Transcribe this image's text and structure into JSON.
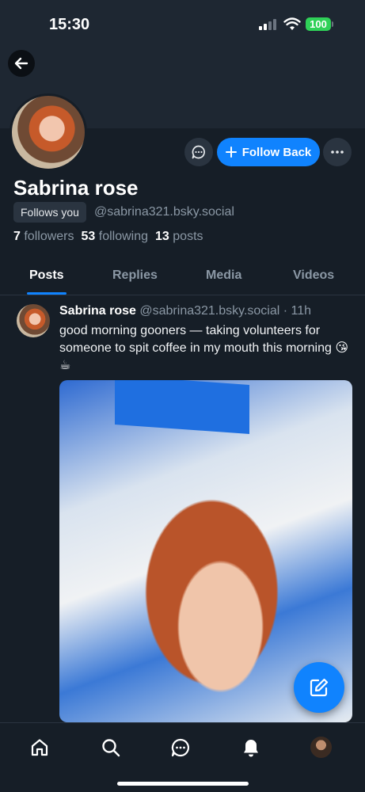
{
  "status_bar": {
    "time": "15:30",
    "battery": "100"
  },
  "profile": {
    "display_name": "Sabrina rose",
    "follows_you": "Follows you",
    "handle": "@sabrina321.bsky.social",
    "followers_count": "7",
    "followers_label": "followers",
    "following_count": "53",
    "following_label": "following",
    "posts_count": "13",
    "posts_label": "posts",
    "follow_button": "Follow Back"
  },
  "tabs": [
    {
      "label": "Posts",
      "active": true
    },
    {
      "label": "Replies",
      "active": false
    },
    {
      "label": "Media",
      "active": false
    },
    {
      "label": "Videos",
      "active": false
    }
  ],
  "post": {
    "author": "Sabrina rose",
    "handle": "@sabrina321.bsky.social",
    "separator": "·",
    "time": "11h",
    "text": "good morning gooners — taking volunteers for someone to spit coffee in my mouth this morning 😘☕"
  },
  "colors": {
    "accent": "#1083fe",
    "background": "#161e27",
    "banner": "#1e2732"
  },
  "icons": {
    "back": "arrow-left-icon",
    "message": "chat-bubble-icon",
    "more": "ellipsis-icon",
    "compose": "pencil-square-icon",
    "nav": [
      "home-icon",
      "search-icon",
      "chat-icon",
      "bell-icon",
      "profile-avatar"
    ]
  }
}
